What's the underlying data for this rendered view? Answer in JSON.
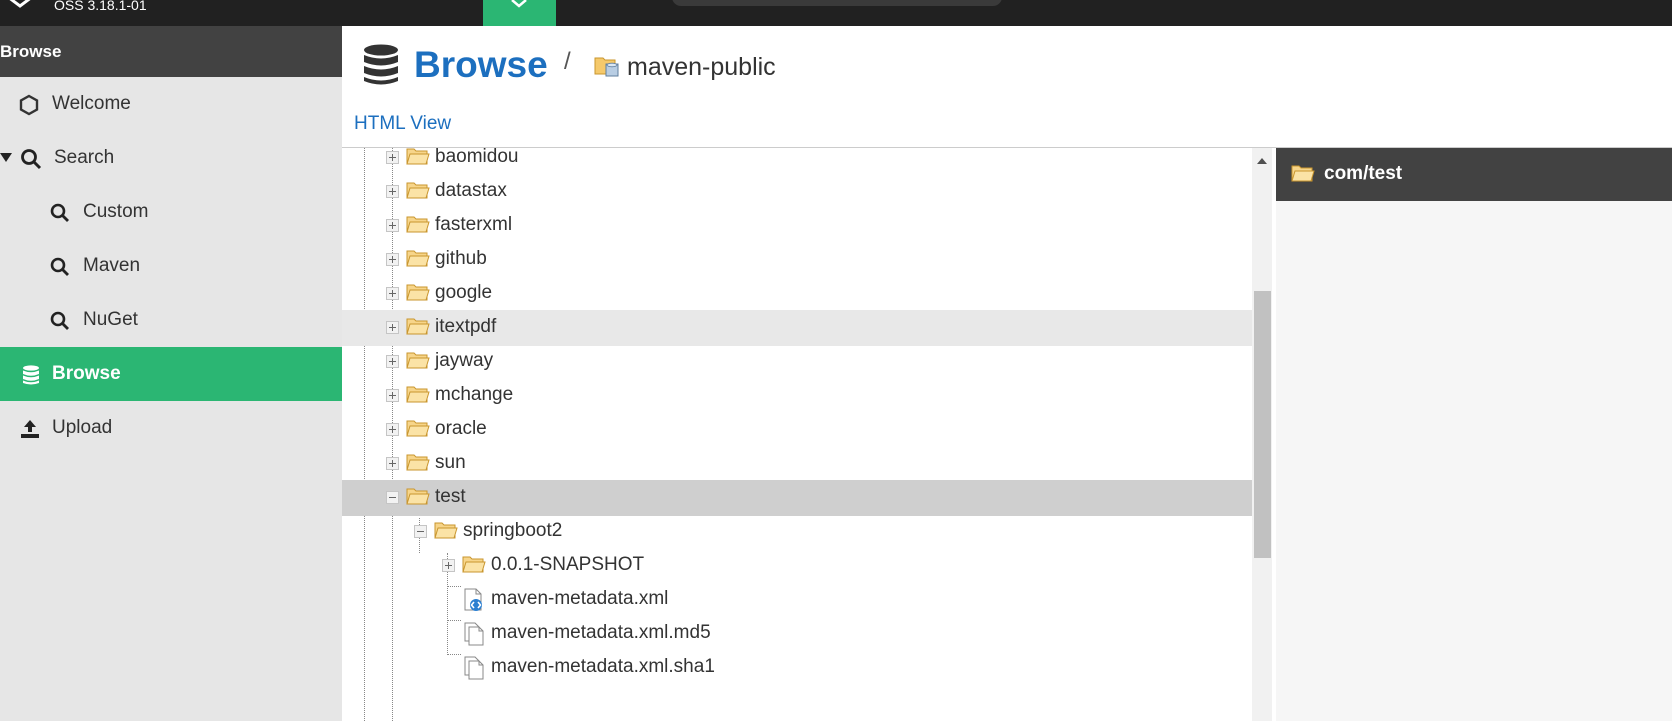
{
  "topbar": {
    "version": "OSS 3.18.1-01"
  },
  "sidebar": {
    "header": "Browse",
    "items": [
      {
        "label": "Welcome",
        "icon": "hexagon-icon"
      },
      {
        "label": "Search",
        "icon": "search-icon",
        "expanded": true
      },
      {
        "label": "Custom",
        "icon": "search-icon"
      },
      {
        "label": "Maven",
        "icon": "search-icon"
      },
      {
        "label": "NuGet",
        "icon": "search-icon"
      },
      {
        "label": "Browse",
        "icon": "database-icon",
        "active": true
      },
      {
        "label": "Upload",
        "icon": "upload-icon"
      }
    ]
  },
  "header": {
    "title": "Browse",
    "separator": "/",
    "repository": "maven-public",
    "html_view": "HTML View"
  },
  "tree": {
    "rows": [
      {
        "label": "baomidou",
        "type": "folder",
        "state": "collapsed"
      },
      {
        "label": "datastax",
        "type": "folder",
        "state": "collapsed"
      },
      {
        "label": "fasterxml",
        "type": "folder",
        "state": "collapsed"
      },
      {
        "label": "github",
        "type": "folder",
        "state": "collapsed"
      },
      {
        "label": "google",
        "type": "folder",
        "state": "collapsed"
      },
      {
        "label": "itextpdf",
        "type": "folder",
        "state": "collapsed",
        "hover": true
      },
      {
        "label": "jayway",
        "type": "folder",
        "state": "collapsed"
      },
      {
        "label": "mchange",
        "type": "folder",
        "state": "collapsed"
      },
      {
        "label": "oracle",
        "type": "folder",
        "state": "collapsed"
      },
      {
        "label": "sun",
        "type": "folder",
        "state": "collapsed"
      },
      {
        "label": "test",
        "type": "folder",
        "state": "expanded",
        "selected": true
      },
      {
        "label": "springboot2",
        "type": "folder",
        "state": "expanded"
      },
      {
        "label": "0.0.1-SNAPSHOT",
        "type": "folder",
        "state": "collapsed"
      },
      {
        "label": "maven-metadata.xml",
        "type": "xml-file"
      },
      {
        "label": "maven-metadata.xml.md5",
        "type": "file"
      },
      {
        "label": "maven-metadata.xml.sha1",
        "type": "file"
      }
    ]
  },
  "detail": {
    "title": "com/test"
  },
  "colors": {
    "accent_green": "#2bb673",
    "dark_bar": "#424242",
    "link_blue": "#1c6fbf",
    "folder_yellow": "#f5c96b"
  }
}
